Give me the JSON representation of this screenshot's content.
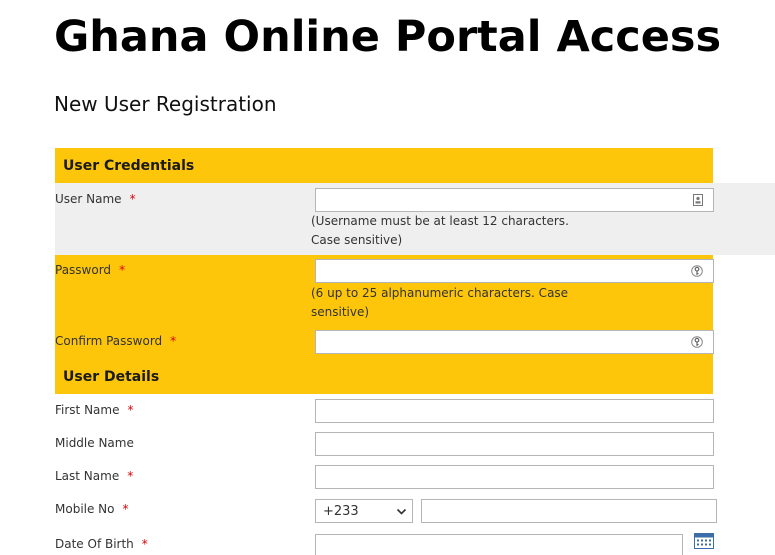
{
  "title": "Ghana Online Portal Access",
  "subtitle": "New User Registration",
  "sections": {
    "credentials": "User Credentials",
    "details": "User Details"
  },
  "required_marker": "*",
  "fields": {
    "username": {
      "label": "User Name",
      "value": "",
      "hint_line1": "(Username must be at least 12 characters.",
      "hint_line2": "Case sensitive)"
    },
    "password": {
      "label": "Password",
      "value": "",
      "hint_line1": "(6 up to 25 alphanumeric characters. Case",
      "hint_line2": "sensitive)"
    },
    "confirm_password": {
      "label": "Confirm Password",
      "value": ""
    },
    "first_name": {
      "label": "First Name",
      "value": ""
    },
    "middle_name": {
      "label": "Middle Name",
      "value": ""
    },
    "last_name": {
      "label": "Last Name",
      "value": ""
    },
    "mobile": {
      "label": "Mobile No",
      "country_code": "+233",
      "value": ""
    },
    "dob": {
      "label": "Date Of Birth",
      "value": ""
    }
  },
  "icons": {
    "username": "id-card-icon",
    "password": "key-icon",
    "confirm_password": "key-icon",
    "dropdown": "chevron-down-icon",
    "calendar": "calendar-icon"
  },
  "colors": {
    "accent": "#fdc60a",
    "grey_row": "#efefef",
    "required": "#e00000"
  }
}
